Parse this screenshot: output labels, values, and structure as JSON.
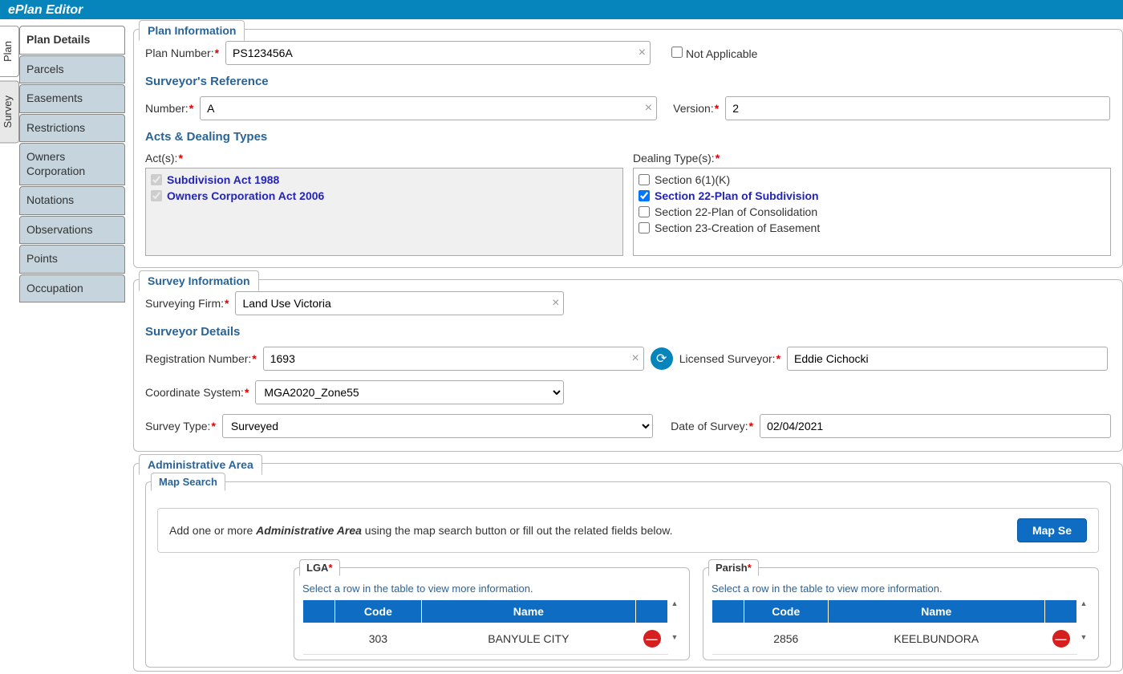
{
  "app_title": "ePlan Editor",
  "vtabs": {
    "plan": "Plan",
    "survey": "Survey"
  },
  "sidebar": {
    "items": [
      "Plan Details",
      "Parcels",
      "Easements",
      "Restrictions",
      "Owners Corporation",
      "Notations",
      "Observations",
      "Points",
      "Occupation"
    ],
    "active_index": 0
  },
  "plan_info": {
    "tab": "Plan Information",
    "plan_number_label": "Plan Number:",
    "plan_number_value": "PS123456A",
    "not_applicable_label": "Not Applicable",
    "surv_ref_heading": "Surveyor's Reference",
    "number_label": "Number:",
    "number_value": "A",
    "version_label": "Version:",
    "version_value": "2",
    "acts_heading": "Acts & Dealing Types",
    "acts_label": "Act(s):",
    "acts": [
      {
        "label": "Subdivision Act 1988",
        "checked": true,
        "disabled": true
      },
      {
        "label": "Owners Corporation Act 2006",
        "checked": true,
        "disabled": true
      }
    ],
    "dealing_label": "Dealing Type(s):",
    "dealing": [
      {
        "label": "Section 6(1)(K)",
        "checked": false
      },
      {
        "label": "Section 22-Plan of Subdivision",
        "checked": true
      },
      {
        "label": "Section 22-Plan of Consolidation",
        "checked": false
      },
      {
        "label": "Section 23-Creation of Easement",
        "checked": false
      }
    ]
  },
  "survey_info": {
    "tab": "Survey Information",
    "firm_label": "Surveying Firm:",
    "firm_value": "Land Use Victoria",
    "details_heading": "Surveyor Details",
    "reg_label": "Registration Number:",
    "reg_value": "1693",
    "lic_label": "Licensed Surveyor:",
    "lic_value": "Eddie Cichocki",
    "coord_label": "Coordinate System:",
    "coord_value": "MGA2020_Zone55",
    "survey_type_label": "Survey Type:",
    "survey_type_value": "Surveyed",
    "date_label": "Date of Survey:",
    "date_value": "02/04/2021"
  },
  "admin": {
    "tab": "Administrative Area",
    "inner_tab": "Map Search",
    "help_prefix": "Add one or more ",
    "help_bold": "Administrative Area",
    "help_suffix": " using the map search button or fill out the related fields below.",
    "map_btn": "Map Se",
    "hint": "Select a row in the table to view more information.",
    "cols": {
      "code": "Code",
      "name": "Name"
    },
    "lga": {
      "title": "LGA",
      "rows": [
        {
          "code": "303",
          "name": "BANYULE CITY"
        }
      ]
    },
    "parish": {
      "title": "Parish",
      "rows": [
        {
          "code": "2856",
          "name": "KEELBUNDORA"
        }
      ]
    }
  }
}
